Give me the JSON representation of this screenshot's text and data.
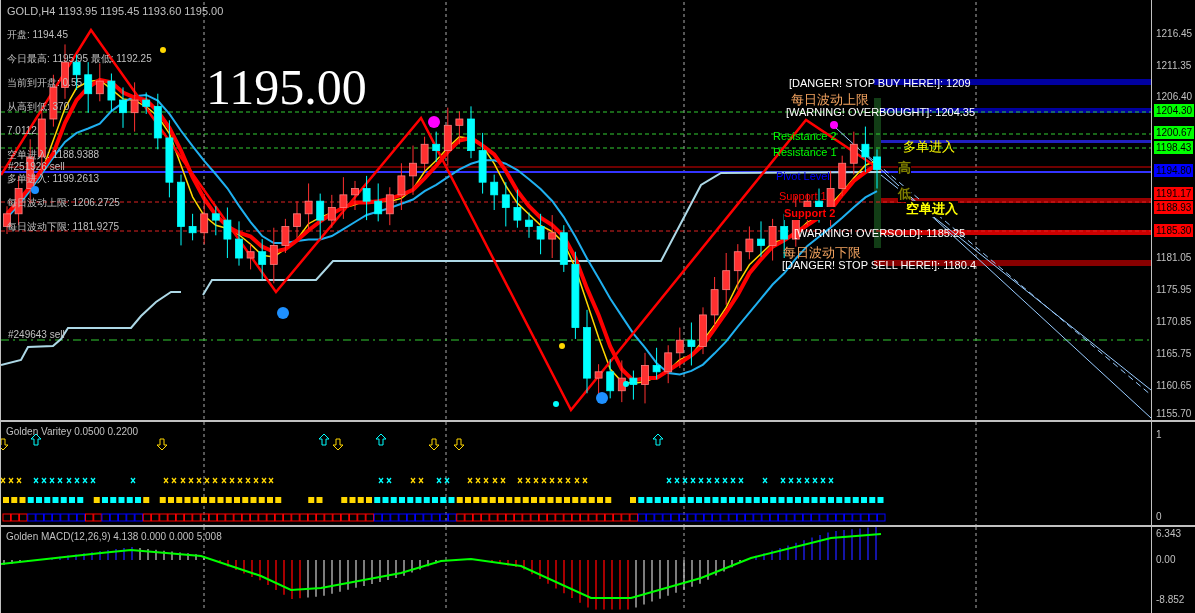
{
  "chart_header": "GOLD,H4  1193.95 1195.45 1193.60 1195.00",
  "big_price": "1195.00",
  "info_lines": [
    "开盘: 1194.45",
    "今日最高: 1195.95  最低: 1192.25",
    "当前到开盘: 0.55",
    "从高到低: 370",
    "7.0112",
    "空单进入: 1188.9388",
    "多单进入: 1199.2613",
    "每日波动上限: 1206.2725",
    "每日波动下限: 1181.9275"
  ],
  "order_labels": [
    "#251926 sell",
    "#249643 sell"
  ],
  "level_labels": [
    {
      "text": "[DANGER! STOP BUY HERE!]: 1209",
      "color": "#ffffff"
    },
    {
      "text": "每日波动上限",
      "color": "#f4a460"
    },
    {
      "text": "[WARNING! OVERBOUGHT]: 1204.35",
      "color": "#ffffff"
    },
    {
      "text": "Resistance 2",
      "color": "#00ff00"
    },
    {
      "text": "多单进入",
      "color": "#ffff00"
    },
    {
      "text": "Resistance 1",
      "color": "#00ff00"
    },
    {
      "text": "高",
      "color": "#808000"
    },
    {
      "text": "Pivot Level",
      "color": "#0000ff"
    },
    {
      "text": "Support 1",
      "color": "#ff0000"
    },
    {
      "text": "低",
      "color": "#808000"
    },
    {
      "text": "空单进入",
      "color": "#ffff00"
    },
    {
      "text": "Support 2",
      "color": "#ff0000"
    },
    {
      "text": "[WARNING! OVERSOLD]: 1185.25",
      "color": "#ffffff"
    },
    {
      "text": "每日波动下限",
      "color": "#f4a460"
    },
    {
      "text": "[DANGER! STOP SELL HERE!]: 1180.4",
      "color": "#ffffff"
    }
  ],
  "price_axis": [
    {
      "text": "1216.45"
    },
    {
      "text": "1211.35"
    },
    {
      "text": "1206.40"
    },
    {
      "text": "1204.30",
      "color": "#00ff00"
    },
    {
      "text": "1200.67",
      "color": "#00ff00"
    },
    {
      "text": "1198.43",
      "color": "#00ff00"
    },
    {
      "text": "1194.80",
      "color": "#0000ff"
    },
    {
      "text": "1191.17",
      "color": "#ff0000"
    },
    {
      "text": "1188.93",
      "color": "#ff0000"
    },
    {
      "text": "1185.30",
      "color": "#ff0000"
    },
    {
      "text": "1181.05"
    },
    {
      "text": "1175.95"
    },
    {
      "text": "1170.85"
    },
    {
      "text": "1165.75"
    },
    {
      "text": "1160.65"
    },
    {
      "text": "1155.70"
    }
  ],
  "variety_panel": {
    "title": "Golden Varitey 0.0500 0.2200",
    "axis": [
      "1",
      "0"
    ]
  },
  "macd_panel": {
    "title": "Golden MACD(12,26,9) 4.138 0.000 0.000 5.008",
    "axis": [
      "6.343",
      "0.00",
      "-8.852"
    ]
  }
}
